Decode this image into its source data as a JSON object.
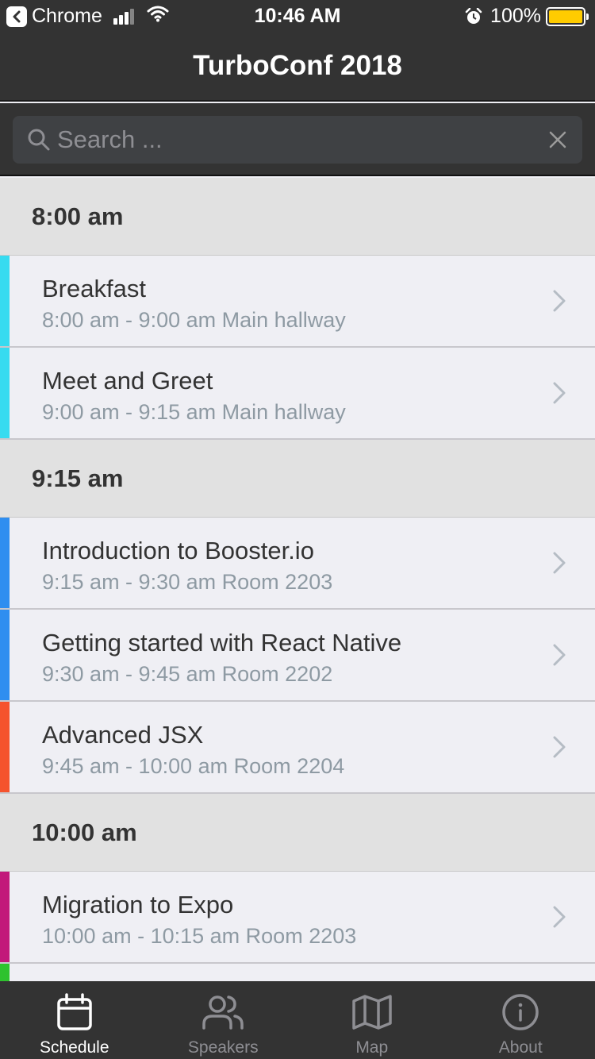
{
  "status_bar": {
    "back_app": "Chrome",
    "time": "10:46 AM",
    "battery": "100%",
    "battery_level": 1.0,
    "battery_color": "#ffcc00"
  },
  "nav": {
    "title": "TurboConf 2018"
  },
  "search": {
    "placeholder": "Search ...",
    "value": ""
  },
  "sections": [
    {
      "time": "8:00 am",
      "sessions": [
        {
          "title": "Breakfast",
          "time_range": "8:00 am - 9:00 am",
          "location": "Main hallway",
          "color": "#37dbf0"
        },
        {
          "title": "Meet and Greet",
          "time_range": "9:00 am - 9:15 am",
          "location": "Main hallway",
          "color": "#37dbf0"
        }
      ]
    },
    {
      "time": "9:15 am",
      "sessions": [
        {
          "title": "Introduction to Booster.io",
          "time_range": "9:15 am - 9:30 am",
          "location": "Room 2203",
          "color": "#2f8ef0"
        },
        {
          "title": "Getting started with React Native",
          "time_range": "9:30 am - 9:45 am",
          "location": "Room 2202",
          "color": "#2f8ef0"
        },
        {
          "title": "Advanced JSX",
          "time_range": "9:45 am - 10:00 am",
          "location": "Room 2204",
          "color": "#f5532d"
        }
      ]
    },
    {
      "time": "10:00 am",
      "sessions": [
        {
          "title": "Migration to Expo",
          "time_range": "10:00 am - 10:15 am",
          "location": "Room 2203",
          "color": "#c2187a"
        },
        {
          "title": "",
          "time_range": "",
          "location": "",
          "color": "#2ec22e"
        }
      ]
    }
  ],
  "tabs": [
    {
      "label": "Schedule",
      "icon": "calendar-icon",
      "active": true
    },
    {
      "label": "Speakers",
      "icon": "users-icon",
      "active": false
    },
    {
      "label": "Map",
      "icon": "map-icon",
      "active": false
    },
    {
      "label": "About",
      "icon": "info-icon",
      "active": false
    }
  ]
}
